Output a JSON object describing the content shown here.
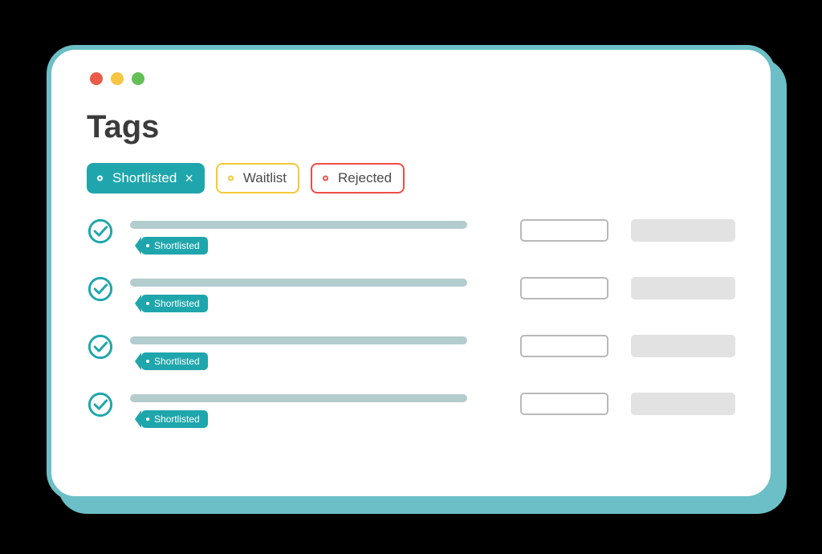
{
  "page": {
    "title": "Tags"
  },
  "traffic_lights": {
    "red": "#ea5b4a",
    "yellow": "#f6c544",
    "green": "#64c056"
  },
  "filters": [
    {
      "label": "Shortlisted",
      "style": "filled-teal",
      "removable": true,
      "close_label": "×"
    },
    {
      "label": "Waitlist",
      "style": "outline-yellow",
      "removable": false
    },
    {
      "label": "Rejected",
      "style": "outline-red",
      "removable": false
    }
  ],
  "rows": [
    {
      "tag": "Shortlisted",
      "checked": true
    },
    {
      "tag": "Shortlisted",
      "checked": true
    },
    {
      "tag": "Shortlisted",
      "checked": true
    },
    {
      "tag": "Shortlisted",
      "checked": true
    }
  ],
  "colors": {
    "teal": "#1fa6ac",
    "frame": "#6cbfc6",
    "yellow": "#f5c935",
    "red": "#ef4d46",
    "placeholder_bar": "#b3ccce",
    "placeholder_box": "#e2e2e2"
  }
}
